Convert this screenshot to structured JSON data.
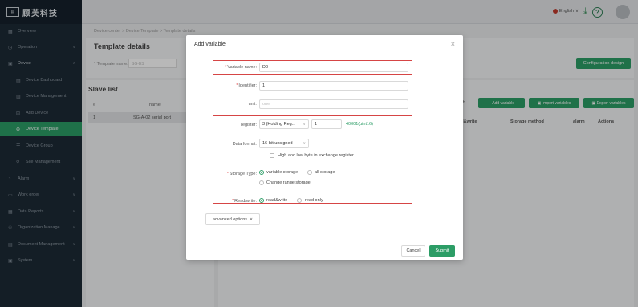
{
  "app": {
    "logo_icon": "logo-mark-icon",
    "logo_text": "顾芙科技"
  },
  "sidebar": {
    "items": [
      {
        "label": "Overview",
        "icon": "▦"
      },
      {
        "label": "Operation",
        "icon": "◷"
      },
      {
        "label": "Device",
        "icon": "▣"
      },
      {
        "label": "Device Dashboard",
        "icon": "▤"
      },
      {
        "label": "Device Management",
        "icon": "▥"
      },
      {
        "label": "Add Device",
        "icon": "⊞"
      },
      {
        "label": "Device Template",
        "icon": "⊕"
      },
      {
        "label": "Device Group",
        "icon": "☰"
      },
      {
        "label": "Site Management",
        "icon": "⚲"
      },
      {
        "label": "Alarm",
        "icon": "◔"
      },
      {
        "label": "Work order",
        "icon": "▭"
      },
      {
        "label": "Data Reports",
        "icon": "▦"
      },
      {
        "label": "Organization Manage...",
        "icon": "⚇"
      },
      {
        "label": "Document Management",
        "icon": "▤"
      },
      {
        "label": "System",
        "icon": "▣"
      }
    ]
  },
  "header": {
    "language": "English",
    "lang_chevron": "∨",
    "download_icon": "⤓",
    "help_icon": "?"
  },
  "page": {
    "breadcrumb": "Device center  >  Device Template  >  Template details",
    "title": "Template details",
    "template_name_label": "* Template name:",
    "template_name_value": "SG-BS",
    "config_button": "Configuration design",
    "slave_list_title": "Slave list",
    "slave_table": {
      "headers": [
        "#",
        "name"
      ],
      "rows": [
        [
          "1",
          "SG-A-02 serial port"
        ]
      ]
    },
    "search_label": "rch",
    "actions": {
      "add_variable": "Add variable",
      "import_variables": "Import variables",
      "export_variables": "Export variables"
    },
    "variable_table_headers": [
      "read&write",
      "Storage method",
      "alarm",
      "Actions"
    ]
  },
  "modal": {
    "title": "Add variable",
    "close": "×",
    "variable_name_label": "Variable name:",
    "variable_name_value": "D0",
    "identifier_label": "Identifier:",
    "identifier_value": "1",
    "unit_label": "unit:",
    "unit_placeholder": "one",
    "register_label": "register:",
    "register_type": "3 (Holding Reg...",
    "register_address": "1",
    "register_hint": "40001(uint16)",
    "data_format_label": "Data format:",
    "data_format_value": "16-bit unsigned",
    "byte_swap_label": "High and low byte in exchange register",
    "storage_type_label": "Storage Type:",
    "storage_variable": "variable storage",
    "storage_all": "all storage",
    "change_range_storage": "Change range storage",
    "read_write_label": "Read/write:",
    "rw_read_write": "read&write",
    "rw_read_only": "read only",
    "advanced_options": "advanced options",
    "cancel": "Cancel",
    "submit": "Submit"
  },
  "colors": {
    "accent": "#2c9d66",
    "sidebar": "#1d2a35",
    "highlight_box": "#d64545"
  }
}
